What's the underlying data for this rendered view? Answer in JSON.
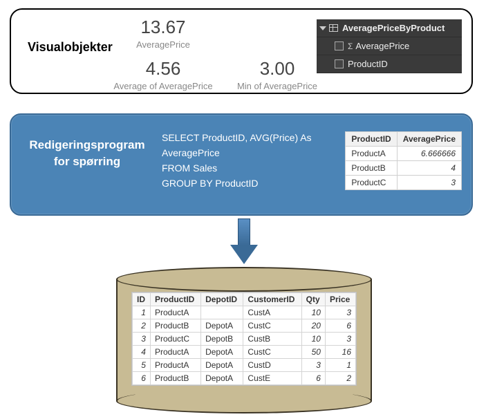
{
  "visuals": {
    "title": "Visualobjekter",
    "m1": {
      "val": "13.67",
      "lbl": "AveragePrice"
    },
    "m2": {
      "val": "4.56",
      "lbl": "Average of AveragePrice"
    },
    "m3": {
      "val": "3.00",
      "lbl": "Min of AveragePrice"
    }
  },
  "fields": {
    "table": "AveragePriceByProduct",
    "f1": "AveragePrice",
    "f2": "ProductID"
  },
  "query": {
    "title1": "Redigeringsprogram",
    "title2": "for spørring",
    "sql": "SELECT ProductID, AVG(Price) As\nAveragePrice\nFROM Sales\nGROUP BY ProductID"
  },
  "result": {
    "h1": "ProductID",
    "h2": "AveragePrice",
    "rows": [
      {
        "p": "ProductA",
        "a": "6.666666"
      },
      {
        "p": "ProductB",
        "a": "4"
      },
      {
        "p": "ProductC",
        "a": "3"
      }
    ]
  },
  "sales": {
    "h": {
      "id": "ID",
      "pid": "ProductID",
      "did": "DepotID",
      "cid": "CustomerID",
      "qty": "Qty",
      "price": "Price"
    },
    "rows": [
      {
        "id": "1",
        "pid": "ProductA",
        "did": "",
        "cid": "CustA",
        "qty": "10",
        "price": "3"
      },
      {
        "id": "2",
        "pid": "ProductB",
        "did": "DepotA",
        "cid": "CustC",
        "qty": "20",
        "price": "6"
      },
      {
        "id": "3",
        "pid": "ProductC",
        "did": "DepotB",
        "cid": "CustB",
        "qty": "10",
        "price": "3"
      },
      {
        "id": "4",
        "pid": "ProductA",
        "did": "DepotA",
        "cid": "CustC",
        "qty": "50",
        "price": "16"
      },
      {
        "id": "5",
        "pid": "ProductA",
        "did": "DepotA",
        "cid": "CustD",
        "qty": "3",
        "price": "1"
      },
      {
        "id": "6",
        "pid": "ProductB",
        "did": "DepotA",
        "cid": "CustE",
        "qty": "6",
        "price": "2"
      }
    ]
  }
}
